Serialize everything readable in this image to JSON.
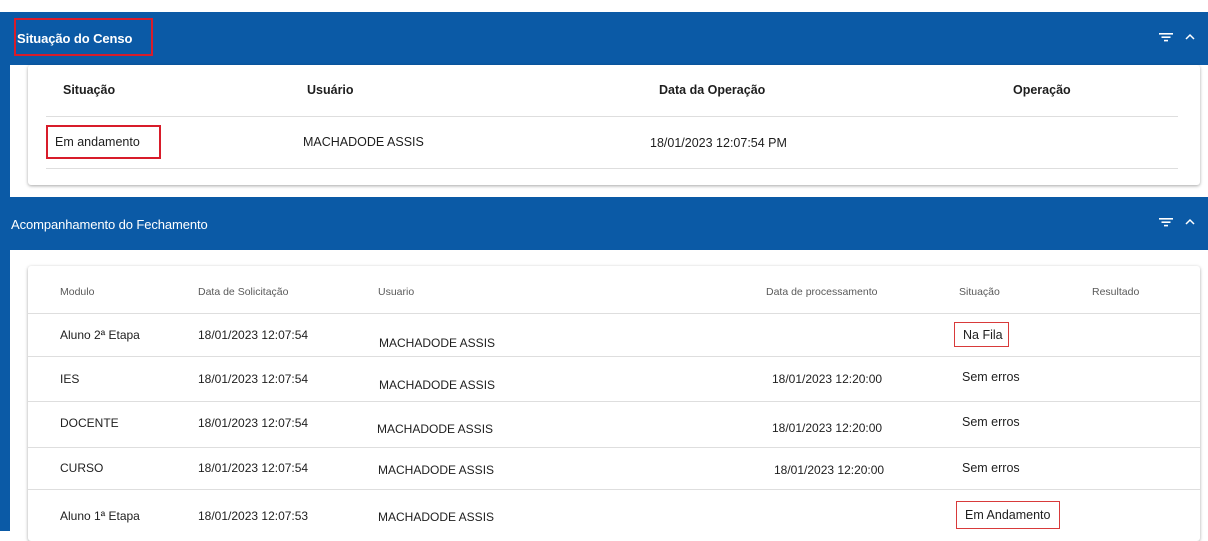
{
  "colors": {
    "header_bg": "#0b5aa6",
    "header_text": "#ffffff",
    "highlight": "#d81c2a"
  },
  "icons": {
    "filter": "filter-icon",
    "collapse": "chevron-up-icon"
  },
  "census_panel": {
    "title": "Situação do Censo",
    "columns": [
      "Situação",
      "Usuário",
      "Data da Operação",
      "Operação"
    ],
    "row": {
      "situacao": "Em andamento",
      "usuario": "MACHADODE ASSIS",
      "data_operacao": "18/01/2023 12:07:54 PM",
      "operacao": ""
    }
  },
  "closing_panel": {
    "title": "Acompanhamento do Fechamento",
    "columns": [
      "Modulo",
      "Data de Solicitação",
      "Usuario",
      "Data de processamento",
      "Situação",
      "Resultado"
    ],
    "rows": [
      {
        "modulo": "Aluno 2ª Etapa",
        "data_solicitacao": "18/01/2023 12:07:54",
        "usuario": "MACHADODE ASSIS",
        "data_processamento": "",
        "situacao": "Na Fila",
        "resultado": ""
      },
      {
        "modulo": "IES",
        "data_solicitacao": "18/01/2023 12:07:54",
        "usuario": "MACHADODE ASSIS",
        "data_processamento": "18/01/2023 12:20:00",
        "situacao": "Sem erros",
        "resultado": ""
      },
      {
        "modulo": "DOCENTE",
        "data_solicitacao": "18/01/2023 12:07:54",
        "usuario": "MACHADODE ASSIS",
        "data_processamento": "18/01/2023 12:20:00",
        "situacao": "Sem erros",
        "resultado": ""
      },
      {
        "modulo": "CURSO",
        "data_solicitacao": "18/01/2023 12:07:54",
        "usuario": "MACHADODE ASSIS",
        "data_processamento": "18/01/2023 12:20:00",
        "situacao": "Sem erros",
        "resultado": ""
      },
      {
        "modulo": "Aluno 1ª Etapa",
        "data_solicitacao": "18/01/2023 12:07:53",
        "usuario": "MACHADODE ASSIS",
        "data_processamento": "",
        "situacao": "Em Andamento",
        "resultado": ""
      }
    ]
  }
}
